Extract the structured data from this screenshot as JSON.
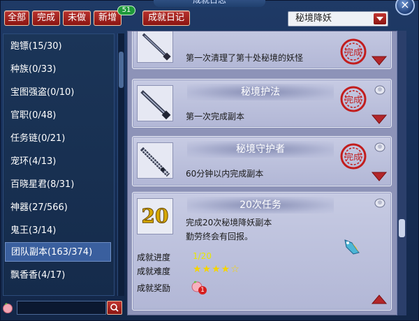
{
  "window": {
    "title": "成就日志",
    "close_label": "×"
  },
  "toolbar": {
    "tabs": [
      "全部",
      "完成",
      "未做",
      "新增"
    ],
    "new_count": "51",
    "diary_label": "成就日记",
    "category_select": "秘境降妖"
  },
  "sidebar": {
    "items": [
      {
        "label": "跑镖(15/30)"
      },
      {
        "label": "种族(0/33)"
      },
      {
        "label": "宝图强盗(0/10)"
      },
      {
        "label": "官职(0/48)"
      },
      {
        "label": "任务链(0/21)"
      },
      {
        "label": "宠环(4/13)"
      },
      {
        "label": "百晓星君(8/31)"
      },
      {
        "label": "神器(27/566)"
      },
      {
        "label": "鬼王(3/14)"
      },
      {
        "label": "团队副本(163/374)"
      },
      {
        "label": "飘香香(4/17)"
      }
    ],
    "active_index": 9
  },
  "search": {
    "placeholder": "",
    "value": ""
  },
  "achievements": [
    {
      "title": "",
      "description": "第一次清理了第十处秘境的妖怪",
      "completed": true,
      "seal_text": "完成"
    },
    {
      "title": "秘境护法",
      "description": "第一次完成副本",
      "completed": true,
      "seal_text": "完成"
    },
    {
      "title": "秘境守护者",
      "description": "60分钟以内完成副本",
      "completed": true,
      "seal_text": "完成"
    },
    {
      "title": "20次任务",
      "icon_text": "20",
      "description_line1": "完成20次秘境降妖副本",
      "description_line2": "勤劳终会有回报。",
      "progress_label": "成就进度",
      "progress_value": "1/20",
      "progress_fraction": 0.05,
      "difficulty_label": "成就难度",
      "difficulty_stars": "★★★★☆",
      "reward_label": "成就奖励",
      "reward_count": "1"
    }
  ],
  "colors": {
    "tab_red": "#a3211d",
    "progress_yellow": "#e8e800",
    "panel_bg": "#8d93b8",
    "seal_red": "#c21d1d"
  }
}
